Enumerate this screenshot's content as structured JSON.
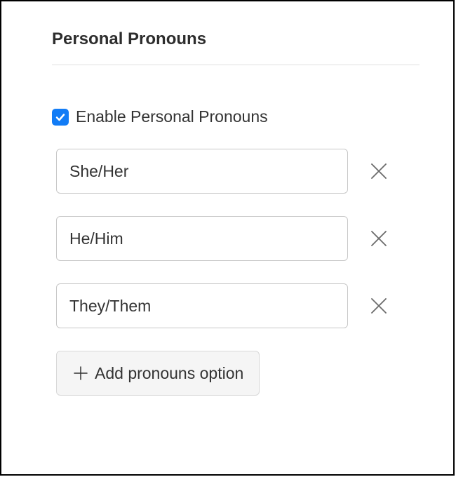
{
  "section": {
    "title": "Personal Pronouns"
  },
  "enable": {
    "checked": true,
    "label": "Enable Personal Pronouns"
  },
  "pronouns": [
    {
      "value": "She/Her"
    },
    {
      "value": "He/Him"
    },
    {
      "value": "They/Them"
    }
  ],
  "addButton": {
    "label": "Add pronouns option"
  }
}
